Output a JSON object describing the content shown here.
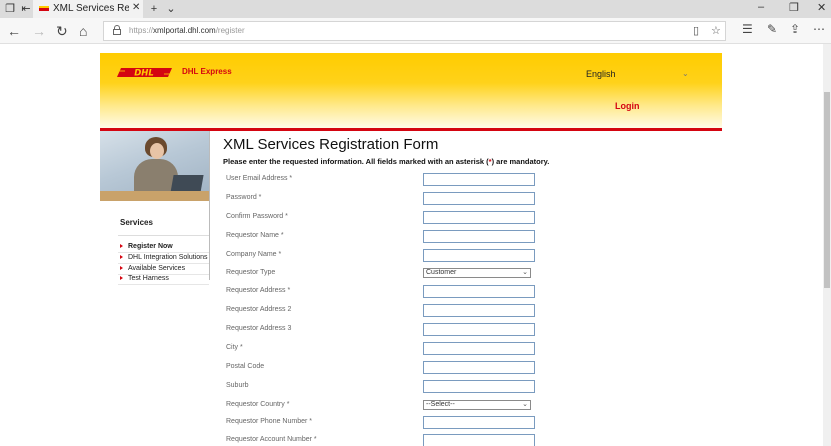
{
  "browser": {
    "tab_title": "XML Services Registratio",
    "url_scheme": "https://",
    "url_host": "xmlportal.dhl.com",
    "url_path": "/register"
  },
  "header": {
    "brand_logo": "DHL",
    "brand_name": "DHL Express",
    "language": "English",
    "login_label": "Login"
  },
  "sidebar": {
    "title": "Services",
    "items": [
      {
        "label": "Register Now"
      },
      {
        "label": "DHL Integration Solutions"
      },
      {
        "label": "Available Services"
      },
      {
        "label": "Test Harness"
      }
    ]
  },
  "form": {
    "title": "XML Services Registration Form",
    "intro_before": "Please enter the requested information. All fields marked with an asterisk (",
    "intro_asterisk": "*",
    "intro_after": ") are mandatory.",
    "fields": [
      {
        "label": "User Email Address *",
        "value": ""
      },
      {
        "label": "Password *",
        "value": ""
      },
      {
        "label": "Confirm Password *",
        "value": ""
      },
      {
        "label": "Requestor Name *",
        "value": ""
      },
      {
        "label": "Company Name *",
        "value": ""
      },
      {
        "label": "Requestor Type",
        "value": "Customer"
      },
      {
        "label": "Requestor Address *",
        "value": ""
      },
      {
        "label": "Requestor Address 2",
        "value": ""
      },
      {
        "label": "Requestor Address 3",
        "value": ""
      },
      {
        "label": "City *",
        "value": ""
      },
      {
        "label": "Postal Code",
        "value": ""
      },
      {
        "label": "Suburb",
        "value": ""
      },
      {
        "label": "Requestor Country *",
        "value": "--Select--"
      },
      {
        "label": "Requestor Phone Number *",
        "value": ""
      },
      {
        "label": "Requestor Account Number *",
        "value": ""
      }
    ]
  },
  "colors": {
    "dhl_red": "#d40511",
    "dhl_yellow": "#ffcc00"
  }
}
